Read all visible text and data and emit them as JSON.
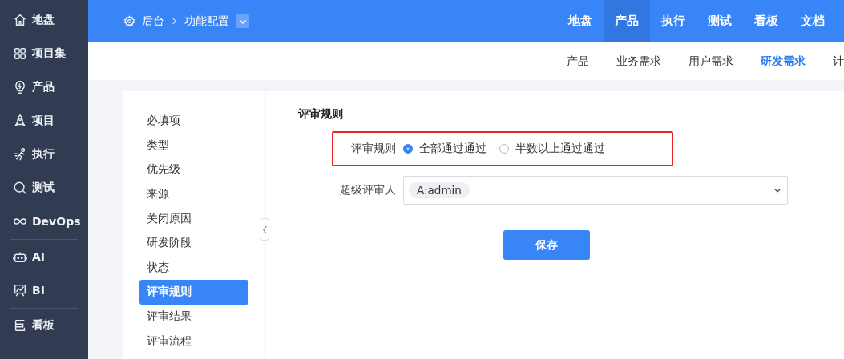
{
  "sidebar": {
    "groups": [
      {
        "items": [
          {
            "label": "地盘"
          },
          {
            "label": "项目集"
          },
          {
            "label": "产品"
          },
          {
            "label": "项目"
          },
          {
            "label": "执行"
          },
          {
            "label": "测试"
          },
          {
            "label": "DevOps"
          }
        ]
      },
      {
        "items": [
          {
            "label": "AI"
          },
          {
            "label": "BI"
          }
        ]
      },
      {
        "items": [
          {
            "label": "看板"
          }
        ]
      }
    ]
  },
  "breadcrumb": {
    "items": [
      "后台",
      "功能配置"
    ]
  },
  "top_nav": [
    {
      "label": "地盘",
      "selected": false
    },
    {
      "label": "产品",
      "selected": true
    },
    {
      "label": "执行",
      "selected": false
    },
    {
      "label": "测试",
      "selected": false
    },
    {
      "label": "看板",
      "selected": false
    },
    {
      "label": "文档",
      "selected": false
    }
  ],
  "sub_nav": [
    {
      "label": "产品",
      "selected": false
    },
    {
      "label": "业务需求",
      "selected": false
    },
    {
      "label": "用户需求",
      "selected": false
    },
    {
      "label": "研发需求",
      "selected": true
    },
    {
      "label": "计"
    }
  ],
  "settings_menu": [
    {
      "label": "必填项",
      "selected": false
    },
    {
      "label": "类型",
      "selected": false
    },
    {
      "label": "优先级",
      "selected": false
    },
    {
      "label": "来源",
      "selected": false
    },
    {
      "label": "关闭原因",
      "selected": false
    },
    {
      "label": "研发阶段",
      "selected": false
    },
    {
      "label": "状态",
      "selected": false
    },
    {
      "label": "评审规则",
      "selected": true
    },
    {
      "label": "评审结果",
      "selected": false
    },
    {
      "label": "评审流程",
      "selected": false
    }
  ],
  "form": {
    "title": "评审规则",
    "review_rule": {
      "label": "评审规则",
      "highlighted": true,
      "options": [
        {
          "label": "全部通过通过",
          "selected": true
        },
        {
          "label": "半数以上通过通过",
          "selected": false
        }
      ]
    },
    "super_reviewer": {
      "label": "超级评审人",
      "tags": [
        "A:admin"
      ]
    },
    "save_button": "保存"
  }
}
